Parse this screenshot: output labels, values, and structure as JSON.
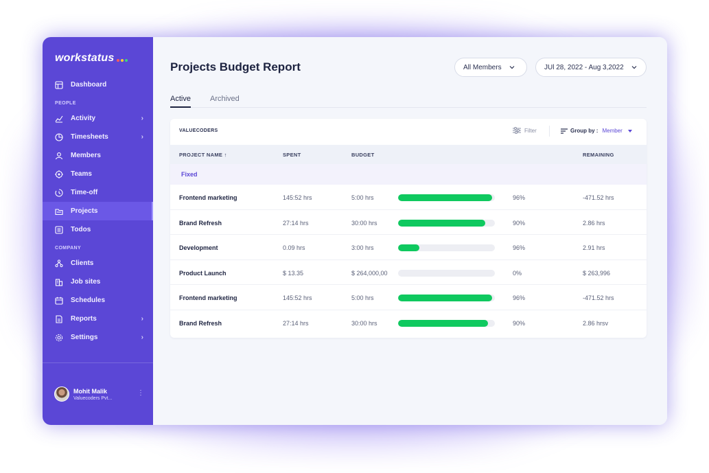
{
  "brand": {
    "name": "workstatus",
    "dot_colors": [
      "#ff5a5a",
      "#ffcc33",
      "#3ad67e"
    ]
  },
  "sidebar": {
    "dashboard": "Dashboard",
    "people_label": "PEOPLE",
    "company_label": "COMPANY",
    "people_items": [
      {
        "label": "Activity",
        "icon": "chart-icon",
        "chevron": true
      },
      {
        "label": "Timesheets",
        "icon": "pie-clock-icon",
        "chevron": true
      },
      {
        "label": "Members",
        "icon": "user-icon",
        "chevron": false
      },
      {
        "label": "Teams",
        "icon": "teams-icon",
        "chevron": false
      },
      {
        "label": "Time-off",
        "icon": "time-off-icon",
        "chevron": false
      },
      {
        "label": "Projects",
        "icon": "folder-icon",
        "chevron": false,
        "active": true
      },
      {
        "label": "Todos",
        "icon": "list-icon",
        "chevron": false
      }
    ],
    "company_items": [
      {
        "label": "Clients",
        "icon": "clients-icon",
        "chevron": false
      },
      {
        "label": "Job sites",
        "icon": "building-icon",
        "chevron": false
      },
      {
        "label": "Schedules",
        "icon": "calendar-icon",
        "chevron": false
      },
      {
        "label": "Reports",
        "icon": "report-icon",
        "chevron": true
      },
      {
        "label": "Settings",
        "icon": "gear-icon",
        "chevron": true
      }
    ],
    "profile": {
      "name": "Mohit Malik",
      "org": "Valuecoders Pvt..."
    }
  },
  "header": {
    "title": "Projects Budget Report",
    "members_select": "All Members",
    "date_range": "JUl 28, 2022 - Aug 3,2022"
  },
  "tabs": {
    "active": "Active",
    "archived": "Archived"
  },
  "table": {
    "org": "VALUECODERS",
    "filter_label": "Filter",
    "group_by_label": "Group by :",
    "group_by_value": "Member",
    "columns": {
      "name": "PROJECT NAME ↑",
      "spent": "SPENT",
      "budget": "BUDGET",
      "remaining": "REMAINING"
    },
    "group": "Fixed",
    "rows": [
      {
        "name": "Frontend marketing",
        "spent": "145:52 hrs",
        "budget": "5:00 hrs",
        "progress": 0.97,
        "percent": "96%",
        "remaining": "-471.52 hrs"
      },
      {
        "name": "Brand Refresh",
        "spent": "27:14 hrs",
        "budget": "30:00 hrs",
        "progress": 0.9,
        "percent": "90%",
        "remaining": "2.86 hrs"
      },
      {
        "name": "Development",
        "spent": "0.09 hrs",
        "budget": "3:00 hrs",
        "progress": 0.22,
        "percent": "96%",
        "remaining": "2.91 hrs"
      },
      {
        "name": "Product Launch",
        "spent": "$ 13.35",
        "budget": "$ 264,000,00",
        "progress": 0,
        "percent": "0%",
        "remaining": "$ 263,996"
      },
      {
        "name": "Frontend marketing",
        "spent": "145:52 hrs",
        "budget": "5:00 hrs",
        "progress": 0.97,
        "percent": "96%",
        "remaining": "-471.52 hrs"
      },
      {
        "name": "Brand Refresh",
        "spent": "27:14 hrs",
        "budget": "30:00 hrs",
        "progress": 0.93,
        "percent": "90%",
        "remaining": "2.86 hrsv"
      }
    ]
  }
}
